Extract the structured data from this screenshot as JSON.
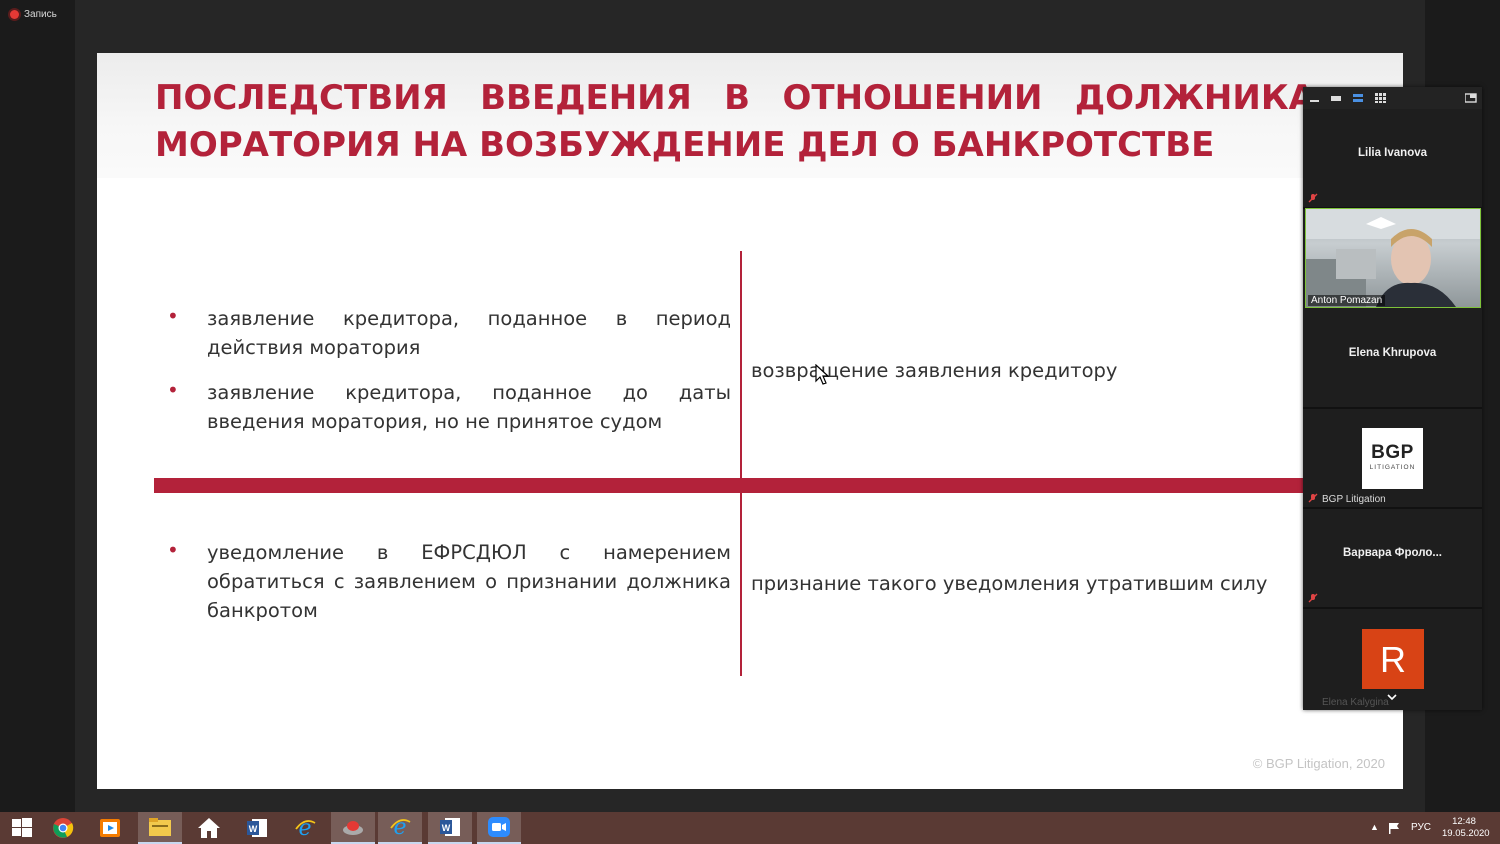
{
  "recording": {
    "label": "Запись"
  },
  "slide": {
    "title_line1_words": [
      "ПОСЛЕДСТВИЯ",
      "ВВЕДЕНИЯ",
      "В",
      "ОТНОШЕНИИ",
      "ДОЛЖНИКА"
    ],
    "title_line2": "МОРАТОРИЯ НА ВОЗБУЖДЕНИЕ ДЕЛ О БАНКРОТСТВЕ",
    "row1_bullets": [
      "заявление кредитора, поданное в период действия моратория",
      "заявление кредитора, поданное до даты введения моратория, но не принятое судом"
    ],
    "row1_result": "возвращение заявления кредитору",
    "row2_bullets": [
      "уведомление в ЕФРСДЮЛ с намерением обратиться с заявлением о признании должника банкротом"
    ],
    "row2_result": "признание такого уведомления утратившим силу",
    "copyright": "© BGP Litigation, 2020",
    "accent_color": "#b3223a"
  },
  "gallery": {
    "participants": [
      {
        "name": "Lilia Ivanova",
        "muted": true
      },
      {
        "name": "Anton Pomazan",
        "video": true
      },
      {
        "name": "Elena Khrupova"
      },
      {
        "name": "BGP Litigation",
        "logo_text": "BGP",
        "logo_sub": "LITIGATION",
        "muted": true
      },
      {
        "name": "Варвара Фроло...",
        "muted": true
      },
      {
        "name": "Elena Kalygina",
        "avatar_letter": "R"
      }
    ],
    "toolbar_icons": [
      "minimize-icon",
      "hide-video-icon",
      "speaker-view-icon",
      "gallery-view-icon",
      "exit-fullscreen-icon"
    ]
  },
  "taskbar": {
    "apps": [
      "windows-start-icon",
      "chrome-icon",
      "media-player-icon",
      "file-explorer-icon",
      "home-icon",
      "word-icon",
      "internet-explorer-icon",
      "red-button-app-icon",
      "internet-explorer-icon-2",
      "word-icon-2",
      "zoom-icon"
    ],
    "language": "РУС",
    "time": "12:48",
    "date": "19.05.2020"
  }
}
